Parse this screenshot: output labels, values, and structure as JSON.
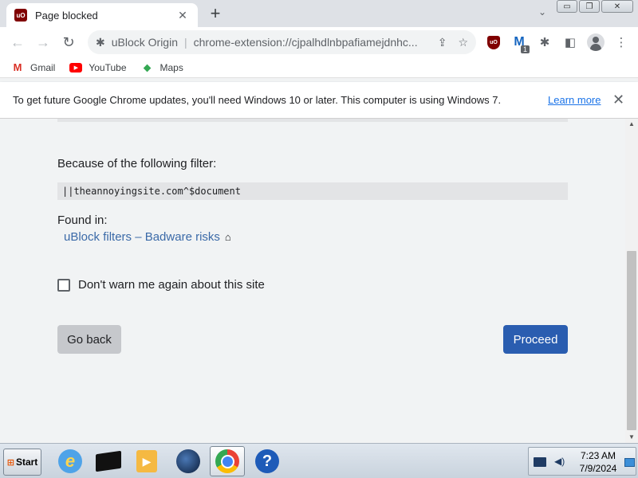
{
  "tab": {
    "title": "Page blocked",
    "favicon": "uBlock-icon",
    "close": "✕"
  },
  "new_tab_label": "+",
  "window_controls": {
    "minimize": "▭",
    "restore": "❐",
    "close": "✕"
  },
  "toolbar": {
    "site_name": "uBlock Origin",
    "url": "chrome-extension://cjpalhdlnbpafiamejdnhc...",
    "badge_count": "1"
  },
  "bookmarks": [
    {
      "label": "Gmail"
    },
    {
      "label": "YouTube"
    },
    {
      "label": "Maps"
    }
  ],
  "infobar": {
    "message": "To get future Google Chrome updates, you'll need Windows 10 or later. This computer is using Windows 7.",
    "link": "Learn more"
  },
  "page": {
    "filter_heading": "Because of the following filter:",
    "filter_text": "||theannoyingsite.com^$document",
    "found_in_label": "Found in:",
    "filter_list": "uBlock filters – Badware risks",
    "dont_warn_label": "Don't warn me again about this site",
    "dont_warn_checked": false,
    "go_back_label": "Go back",
    "proceed_label": "Proceed"
  },
  "taskbar": {
    "start_label": "Start",
    "time": "7:23 AM",
    "date": "7/9/2024"
  },
  "colors": {
    "proceed_button": "#2a5db0",
    "link": "#3b6aa8",
    "ublock_brand": "#800000"
  }
}
